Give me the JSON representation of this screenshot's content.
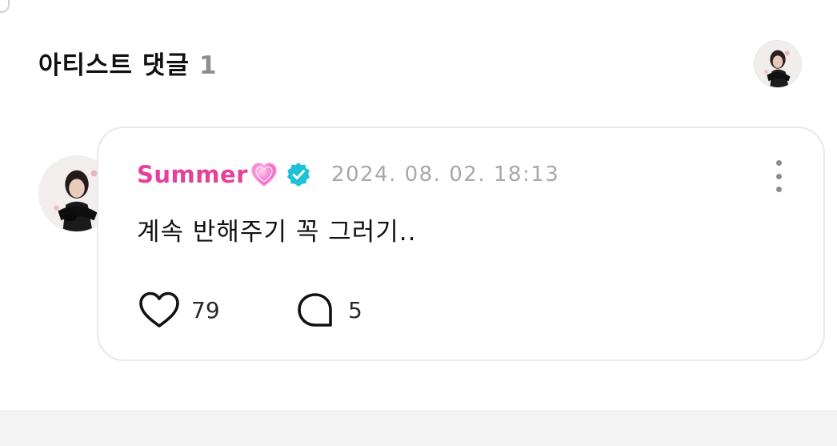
{
  "section": {
    "title": "아티스트 댓글",
    "count": "1"
  },
  "header_avatar": {
    "name": "artist-avatar"
  },
  "comment": {
    "author": "Summer",
    "author_emoji": "pink-heart",
    "verified": true,
    "date": "2024. 08. 02. 18:13",
    "text": "계속 반해주기 꼭 그러기..",
    "likes": "79",
    "replies": "5",
    "more_icon": "more-vertical-icon"
  },
  "colors": {
    "author": "#e5409a",
    "verified_badge": "#1fc1d6",
    "date": "#a8a8a8",
    "card_border": "#e9e9e9",
    "count_gray": "#8e8e8e",
    "bottom_band": "#f3f3f3"
  },
  "icons": {
    "like": "heart-outline-icon",
    "reply": "speech-bubble-icon",
    "verified": "verified-check-icon",
    "more": "more-vertical-icon"
  }
}
